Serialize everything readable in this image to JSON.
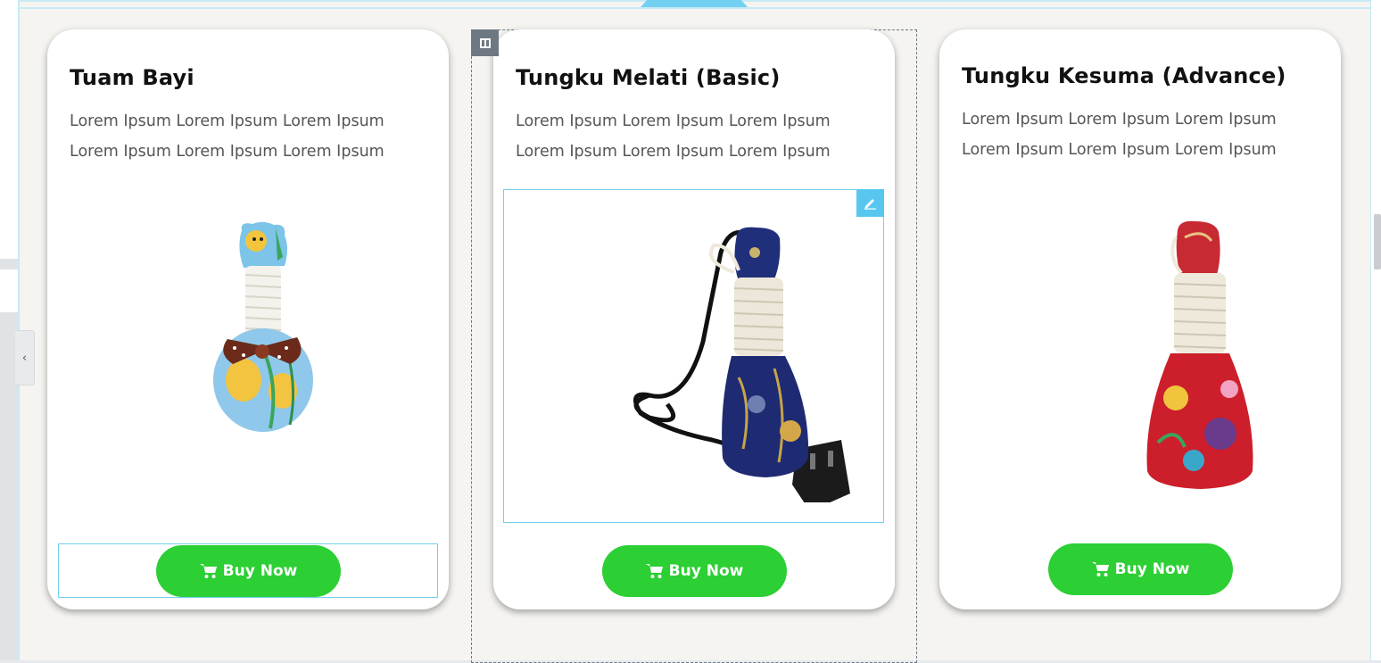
{
  "editor": {
    "collapse_glyph": "‹",
    "column_handle_icon": "columns-icon",
    "edit_icon": "pencil-icon"
  },
  "colors": {
    "buy_button": "#2ccf34",
    "selection": "#71d1f0",
    "canvas_bg": "#f5f4f1"
  },
  "products": [
    {
      "title": "Tuam Bayi",
      "description_line1": "Lorem Ipsum Lorem Ipsum Lorem Ipsum",
      "description_line2": "Lorem Ipsum Lorem Ipsum Lorem Ipsum",
      "button_label": "Buy Now",
      "button_icon": "cart-icon"
    },
    {
      "title": "Tungku Melati (Basic)",
      "description_line1": "Lorem Ipsum Lorem Ipsum Lorem Ipsum",
      "description_line2": "Lorem Ipsum Lorem Ipsum Lorem Ipsum",
      "button_label": "Buy Now",
      "button_icon": "cart-icon"
    },
    {
      "title": "Tungku Kesuma (Advance)",
      "description_line1": "Lorem Ipsum Lorem Ipsum Lorem Ipsum",
      "description_line2": "Lorem Ipsum Lorem Ipsum Lorem Ipsum",
      "button_label": "Buy Now",
      "button_icon": "cart-icon"
    }
  ]
}
